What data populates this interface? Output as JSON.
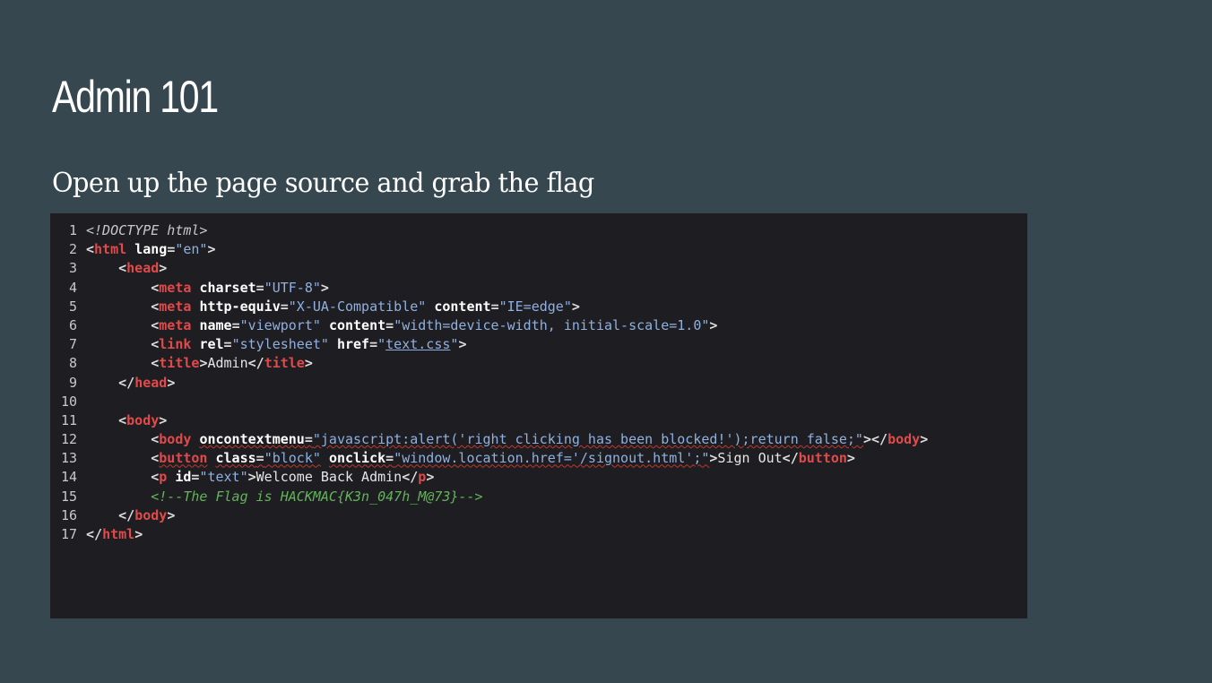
{
  "slide": {
    "title": "Admin 101",
    "subtitle": "Open up the page source and grab the flag"
  },
  "code": {
    "lines": [
      {
        "n": "1"
      },
      {
        "n": "2"
      },
      {
        "n": "3"
      },
      {
        "n": "4"
      },
      {
        "n": "5"
      },
      {
        "n": "6"
      },
      {
        "n": "7"
      },
      {
        "n": "8"
      },
      {
        "n": "9"
      },
      {
        "n": "10"
      },
      {
        "n": "11"
      },
      {
        "n": "12"
      },
      {
        "n": "13"
      },
      {
        "n": "14"
      },
      {
        "n": "15"
      },
      {
        "n": "16"
      },
      {
        "n": "17"
      }
    ],
    "doctype": "<!DOCTYPE html>",
    "t": {
      "html": "html",
      "head": "head",
      "meta": "meta",
      "link": "link",
      "title": "title",
      "body": "body",
      "button": "button",
      "p": "p"
    },
    "a": {
      "lang": "lang",
      "charset": "charset",
      "http_equiv": "http-equiv",
      "content": "content",
      "name": "name",
      "rel": "rel",
      "href": "href",
      "oncontextmenu": "oncontextmenu",
      "class": "class",
      "onclick": "onclick",
      "id": "id"
    },
    "v": {
      "en": "\"en\"",
      "utf8": "\"UTF-8\"",
      "xua": "\"X-UA-Compatible\"",
      "ieedge": "\"IE=edge\"",
      "viewport": "\"viewport\"",
      "viewport_content": "\"width=device-width, initial-scale=1.0\"",
      "stylesheet": "\"stylesheet\"",
      "textcss": "text.css",
      "js": "\"javascript:alert('right clicking has been blocked!');return false;\"",
      "block": "\"block\"",
      "onclick": "\"window.location.href='/signout.html';\"",
      "text": "\"text\""
    },
    "title_text": "Admin",
    "signout_text": "Sign Out",
    "welcome_text": "Welcome Back Admin",
    "comment": "<!--The Flag is HACKMAC{K3n_047h_M@73}-->"
  }
}
